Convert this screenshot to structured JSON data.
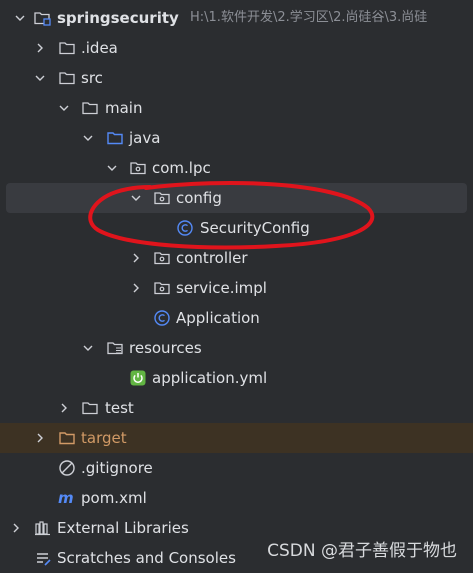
{
  "project": {
    "name": "springsecurity",
    "path_hint": "H:\\1.软件开发\\2.学习区\\2.尚硅谷\\3.尚硅"
  },
  "tree": {
    "idea": ".idea",
    "src": "src",
    "main": "main",
    "java": "java",
    "package": "com.lpc",
    "config": "config",
    "security_config": "SecurityConfig",
    "controller": "controller",
    "service_impl": "service.impl",
    "application": "Application",
    "resources": "resources",
    "application_yml": "application.yml",
    "test": "test",
    "target": "target",
    "gitignore": ".gitignore",
    "pom": "pom.xml",
    "external_libraries": "External Libraries",
    "scratches": "Scratches and Consoles"
  },
  "watermark": "CSDN @君子善假于物也",
  "colors": {
    "background": "#2b2d30",
    "selection": "#393b40",
    "excluded_row": "#3d3223",
    "annotation": "#e0141c",
    "class_icon": "#548af7",
    "spring": "#62b543",
    "target_folder": "#d19a66"
  },
  "icons": {
    "project": "module-folder-icon",
    "folder": "folder-icon",
    "source_folder": "source-root-icon",
    "package": "package-icon",
    "class": "class-icon",
    "resources": "resources-root-icon",
    "yaml": "spring-config-icon",
    "gitignore": "ignore-file-icon",
    "maven": "maven-icon",
    "libraries": "libraries-icon",
    "scratches": "scratches-icon"
  }
}
